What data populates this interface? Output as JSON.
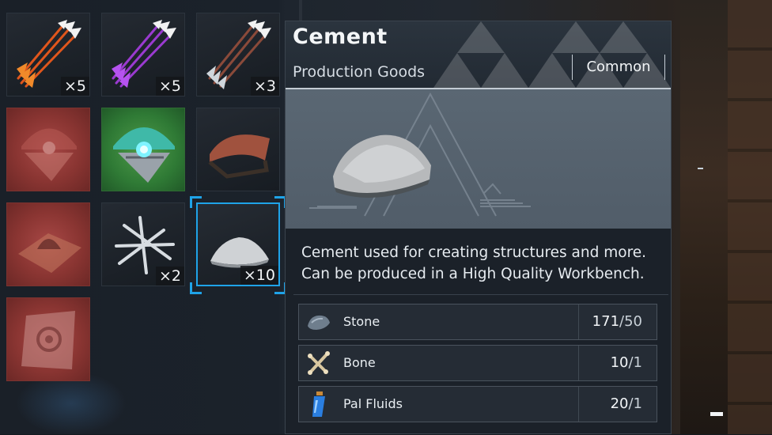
{
  "inventory": {
    "slots": [
      {
        "name": "fire-arrow-bundle",
        "qty": "×5"
      },
      {
        "name": "poison-arrow-bundle",
        "qty": "×5"
      },
      {
        "name": "arrow-bundle",
        "qty": "×3"
      },
      {
        "name": "locked-device",
        "qty": ""
      },
      {
        "name": "glowing-device",
        "qty": ""
      },
      {
        "name": "cloth-glider",
        "qty": ""
      },
      {
        "name": "locked-pile",
        "qty": ""
      },
      {
        "name": "nails",
        "qty": "×2"
      },
      {
        "name": "cement",
        "qty": "×10"
      },
      {
        "name": "locked-tile",
        "qty": ""
      }
    ]
  },
  "tooltip": {
    "name": "Cement",
    "category": "Production Goods",
    "rarity": "Common",
    "description_line1": "Cement used for creating structures and more.",
    "description_line2": "Can be produced in a High Quality Workbench.",
    "requirements": [
      {
        "name": "Stone",
        "have": "171",
        "need": "/50",
        "icon": "stone-icon"
      },
      {
        "name": "Bone",
        "have": "10",
        "need": "/1",
        "icon": "bone-icon"
      },
      {
        "name": "Pal Fluids",
        "have": "20",
        "need": "/1",
        "icon": "pal-fluids-icon"
      }
    ]
  },
  "colors": {
    "selection": "#1fa3e8",
    "locked_slot": "#8a3532",
    "panel": "#1b2129"
  }
}
